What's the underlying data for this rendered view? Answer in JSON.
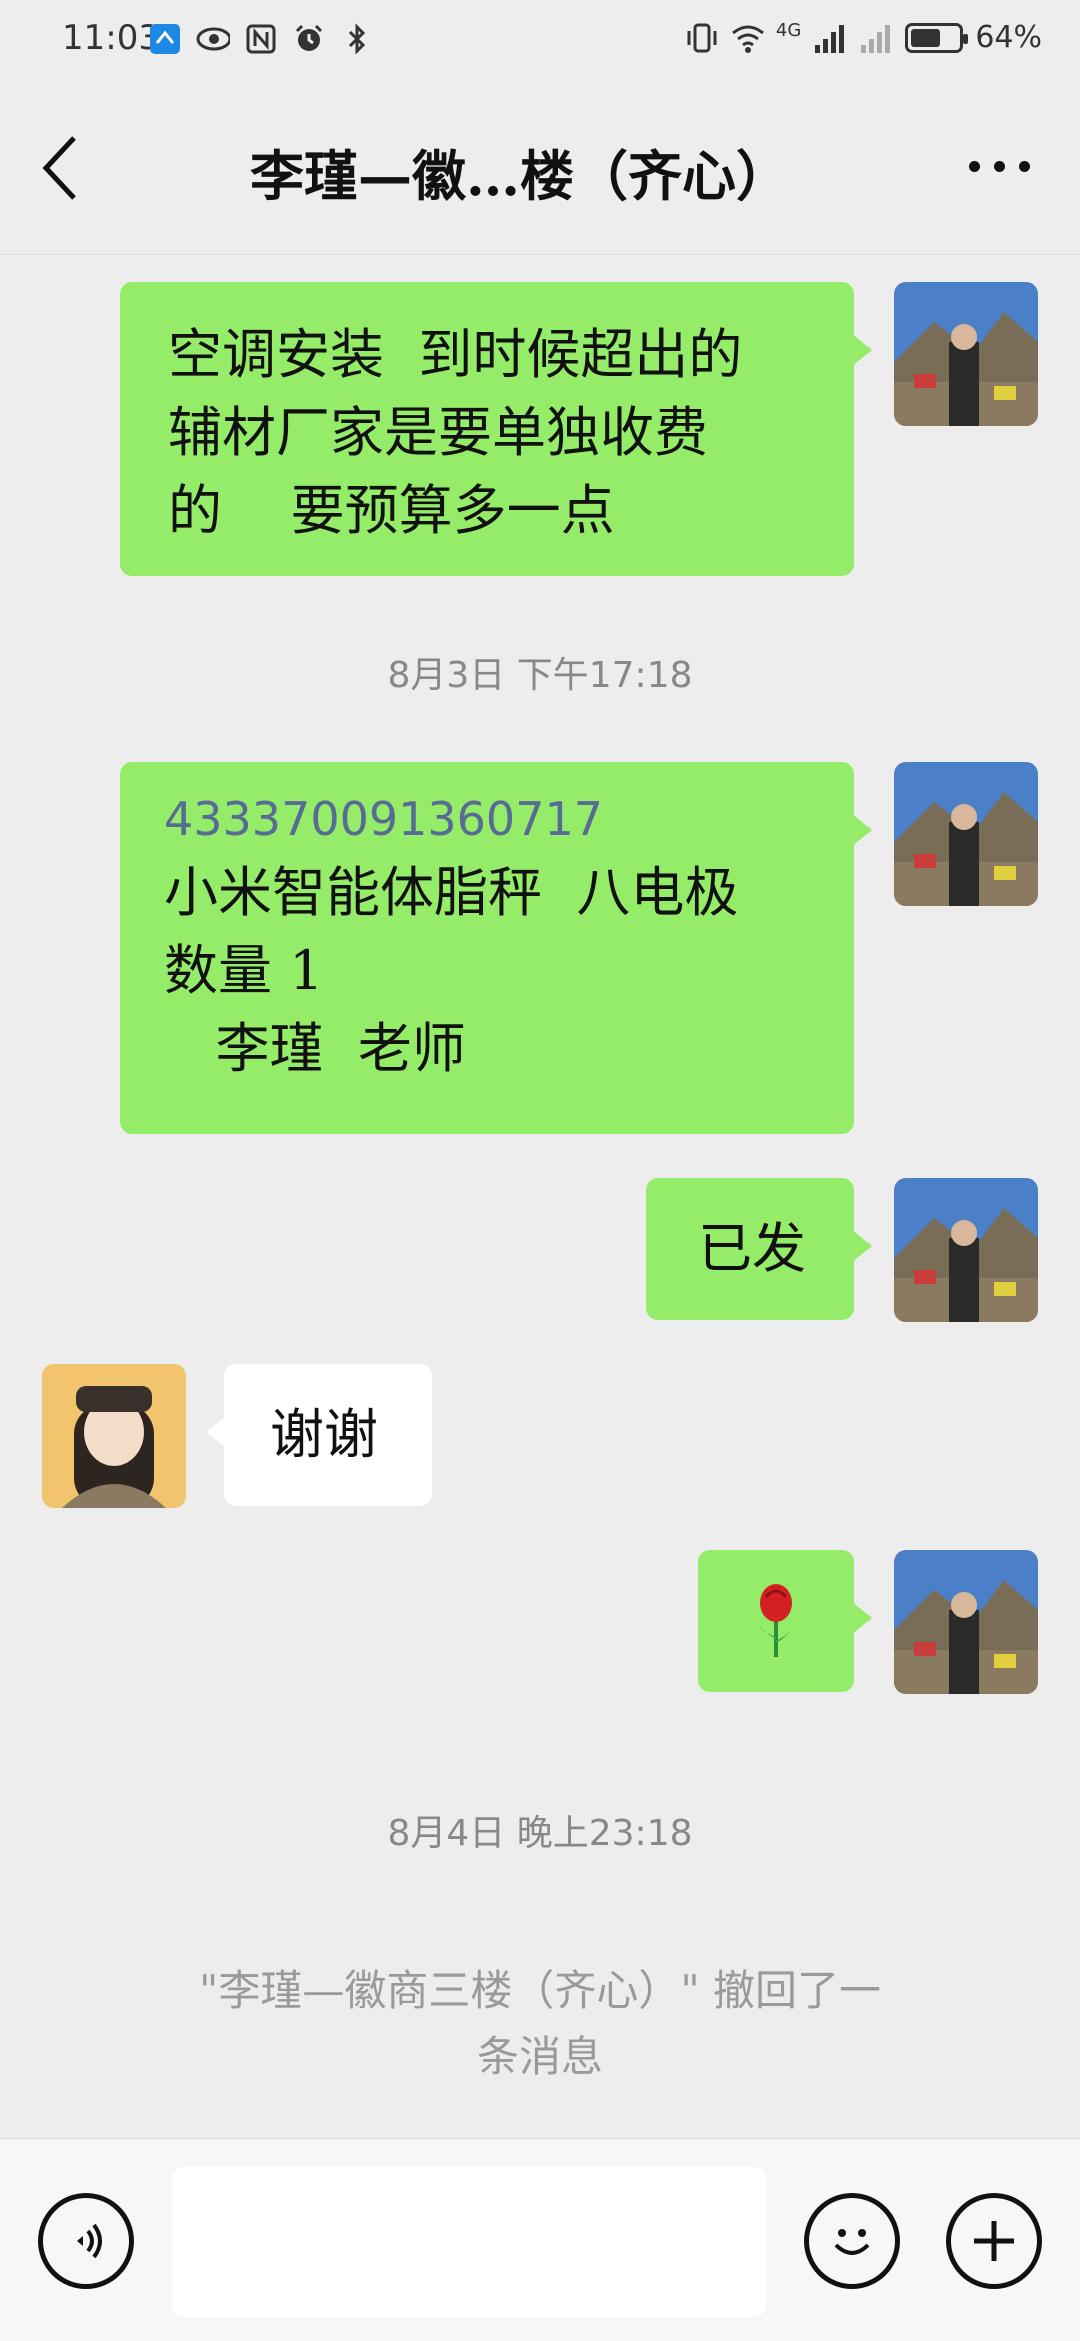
{
  "status_bar": {
    "time": "11:03",
    "network": "4G",
    "battery": "64%",
    "battery_level": 0.64,
    "icons_left": [
      "app-notification-icon",
      "eye-icon",
      "nfc-icon",
      "alarm-icon",
      "bluetooth-icon"
    ],
    "icons_right": [
      "vibrate-icon",
      "wifi-icon",
      "signal-icon",
      "signal-icon-2",
      "battery-icon"
    ]
  },
  "nav": {
    "title": "李瑾—徽…楼（齐心）",
    "back_icon": "chevron-left-icon",
    "more_icon": "more-icon"
  },
  "messages": [
    {
      "side": "me",
      "lines": [
        "空调安装  到时候超出的",
        "辅材厂家是要单独收费",
        "的    要预算多一点"
      ]
    },
    {
      "type": "time",
      "text": "8月3日  下午17:18"
    },
    {
      "side": "me",
      "order_no": "433370091360717",
      "lines": [
        "小米智能体脂秤  八电极",
        "数量 1",
        "   李瑾  老师"
      ]
    },
    {
      "side": "me",
      "lines": [
        "已发"
      ]
    },
    {
      "side": "other",
      "lines": [
        "谢谢"
      ]
    },
    {
      "side": "me",
      "emoji": "🌹"
    },
    {
      "type": "time",
      "text": "8月4日  晚上23:18"
    },
    {
      "type": "recall",
      "lines": [
        "\"李瑾—徽商三楼（齐心）\" 撤回了一",
        "条消息"
      ]
    }
  ],
  "input_bar": {
    "voice_icon": "voice-icon",
    "emoji_icon": "emoji-icon",
    "plus_icon": "plus-icon",
    "text_value": ""
  },
  "colors": {
    "background": "#ededed",
    "my_bubble": "#95ec69",
    "other_bubble": "#ffffff",
    "link_blue": "#576b95",
    "hint_gray": "#888888"
  }
}
